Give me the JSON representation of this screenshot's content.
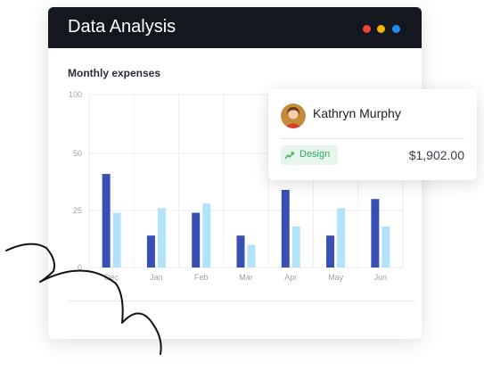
{
  "window": {
    "title": "Data Analysis",
    "controls": [
      {
        "name": "close",
        "color": "#f04438"
      },
      {
        "name": "minimize",
        "color": "#f5b400"
      },
      {
        "name": "maximize",
        "color": "#1f8cf0"
      }
    ]
  },
  "chart_data": {
    "type": "bar",
    "title": "Monthly expenses",
    "categories": [
      "Dec",
      "Jan",
      "Feb",
      "Mar",
      "Apr",
      "May",
      "Jun"
    ],
    "y_ticks": [
      "100",
      "50",
      "25",
      "0"
    ],
    "series": [
      {
        "color": "#3a4fb4",
        "values": [
          41,
          14,
          24,
          14,
          34,
          14,
          30
        ]
      },
      {
        "color": "#b3e3fa",
        "values": [
          24,
          26,
          28,
          10,
          18,
          26,
          18
        ]
      }
    ],
    "grid": true
  },
  "card": {
    "name": "Kathryn Murphy",
    "tag": "Design",
    "tag_icon": "trend-up-icon",
    "amount": "$1,902.00",
    "tag_color": "#2eaa5a"
  }
}
